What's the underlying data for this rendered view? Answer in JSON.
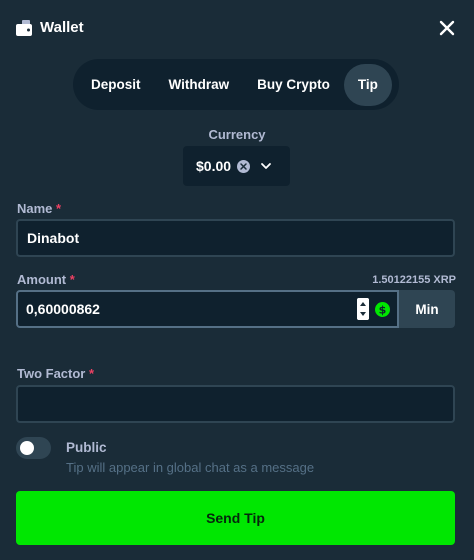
{
  "header": {
    "title": "Wallet"
  },
  "tabs": [
    {
      "label": "Deposit",
      "active": false
    },
    {
      "label": "Withdraw",
      "active": false
    },
    {
      "label": "Buy Crypto",
      "active": false
    },
    {
      "label": "Tip",
      "active": true
    }
  ],
  "currency": {
    "label": "Currency",
    "value": "$0.00"
  },
  "name_field": {
    "label": "Name",
    "required_mark": "*",
    "value": "Dinabot"
  },
  "amount_field": {
    "label": "Amount",
    "required_mark": "*",
    "value": "0,60000862",
    "balance": "1.50122155 XRP",
    "min_label": "Min"
  },
  "two_factor": {
    "label": "Two Factor",
    "required_mark": "*",
    "value": ""
  },
  "public": {
    "label": "Public",
    "description": "Tip will appear in global chat as a message",
    "enabled": false
  },
  "send": {
    "label": "Send Tip"
  },
  "colors": {
    "accent": "#00e701",
    "background": "#1a2c38",
    "input_bg": "#0f212e",
    "surface": "#2f4553",
    "required": "#ed4163"
  },
  "icons": [
    "wallet-icon",
    "close-icon",
    "coin-icon",
    "chevron-down-icon",
    "stepper-icon",
    "dollar-icon"
  ]
}
